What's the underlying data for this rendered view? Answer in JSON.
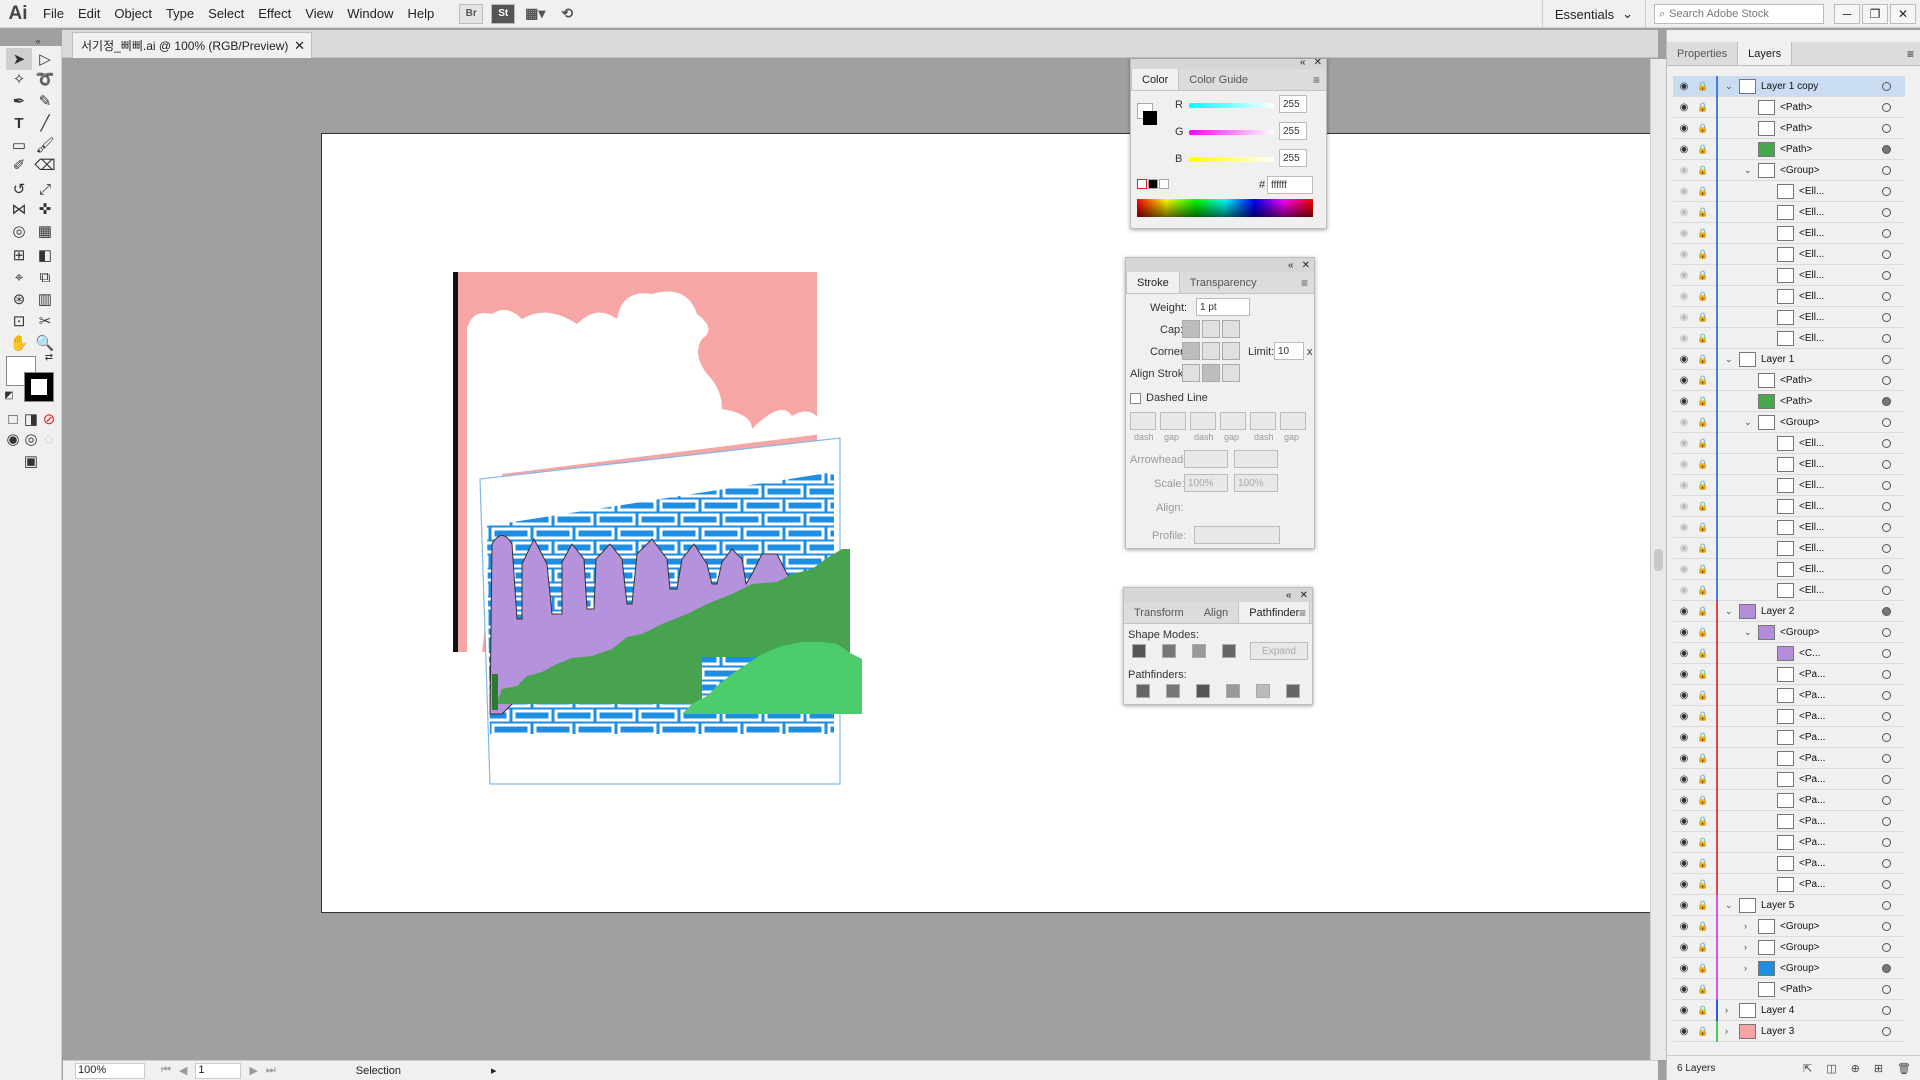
{
  "app": {
    "logo": "Ai"
  },
  "menubar": {
    "items": [
      "File",
      "Edit",
      "Object",
      "Type",
      "Select",
      "Effect",
      "View",
      "Window",
      "Help"
    ],
    "bridge_label": "Br",
    "stock_label": "St",
    "workspace": "Essentials",
    "search_placeholder": "Search Adobe Stock"
  },
  "document": {
    "tab_title": "서기정_삐삐.ai @ 100% (RGB/Preview)"
  },
  "status": {
    "zoom": "100%",
    "artboard": "1",
    "tool": "Selection"
  },
  "color_panel": {
    "tabs": [
      "Color",
      "Color Guide"
    ],
    "r_label": "R",
    "g_label": "G",
    "b_label": "B",
    "r": "255",
    "g": "255",
    "b": "255",
    "hex_label": "#",
    "hex": "ffffff"
  },
  "stroke_panel": {
    "tabs": [
      "Stroke",
      "Transparency"
    ],
    "weight_label": "Weight:",
    "weight": "1 pt",
    "cap_label": "Cap:",
    "corner_label": "Corner:",
    "limit_label": "Limit:",
    "limit": "10",
    "limit_unit": "x",
    "align_label": "Align Stroke:",
    "dashed_label": "Dashed Line",
    "dash_labels": [
      "dash",
      "gap",
      "dash",
      "gap",
      "dash",
      "gap"
    ],
    "arrowheads_label": "Arrowheads:",
    "scale_label": "Scale:",
    "scale1": "100%",
    "scale2": "100%",
    "align2_label": "Align:",
    "profile_label": "Profile:"
  },
  "pathfinder_panel": {
    "tabs": [
      "Transform",
      "Align",
      "Pathfinder"
    ],
    "shape_modes_label": "Shape Modes:",
    "expand_label": "Expand",
    "pathfinders_label": "Pathfinders:"
  },
  "dock": {
    "tabs": [
      "Properties",
      "Layers"
    ]
  },
  "layers": [
    {
      "name": "Layer 1 copy",
      "level": 0,
      "color": "#4a7be0",
      "expand": "v",
      "sel": true,
      "eye": true,
      "lock": true,
      "thumb": "#ffffff",
      "target": "ring"
    },
    {
      "name": "<Path>",
      "level": 1,
      "color": "#4a7be0",
      "eye": true,
      "lock": true,
      "thumb": "#ffffff",
      "target": "ring"
    },
    {
      "name": "<Path>",
      "level": 1,
      "color": "#4a7be0",
      "eye": true,
      "lock": false,
      "thumb": "#ffffff",
      "target": "ring"
    },
    {
      "name": "<Path>",
      "level": 1,
      "color": "#4a7be0",
      "eye": true,
      "lock": false,
      "thumb": "#47a84d",
      "target": "fill"
    },
    {
      "name": "<Group>",
      "level": 1,
      "color": "#4a7be0",
      "expand": "v",
      "eye": false,
      "lock": false,
      "thumb": "#ffffff",
      "target": "ring"
    },
    {
      "name": "<Ell...",
      "level": 2,
      "color": "#4a7be0",
      "eye": false,
      "lock": false,
      "thumb": "#ffffff",
      "target": "ring"
    },
    {
      "name": "<Ell...",
      "level": 2,
      "color": "#4a7be0",
      "eye": false,
      "lock": false,
      "thumb": "#ffffff",
      "target": "ring"
    },
    {
      "name": "<Ell...",
      "level": 2,
      "color": "#4a7be0",
      "eye": false,
      "lock": false,
      "thumb": "#ffffff",
      "target": "ring"
    },
    {
      "name": "<Ell...",
      "level": 2,
      "color": "#4a7be0",
      "eye": false,
      "lock": false,
      "thumb": "#ffffff",
      "target": "ring"
    },
    {
      "name": "<Ell...",
      "level": 2,
      "color": "#4a7be0",
      "eye": false,
      "lock": false,
      "thumb": "#ffffff",
      "target": "ring"
    },
    {
      "name": "<Ell...",
      "level": 2,
      "color": "#4a7be0",
      "eye": false,
      "lock": false,
      "thumb": "#ffffff",
      "target": "ring"
    },
    {
      "name": "<Ell...",
      "level": 2,
      "color": "#4a7be0",
      "eye": false,
      "lock": false,
      "thumb": "#ffffff",
      "target": "ring"
    },
    {
      "name": "<Ell...",
      "level": 2,
      "color": "#4a7be0",
      "eye": false,
      "lock": false,
      "thumb": "#ffffff",
      "target": "ring"
    },
    {
      "name": "Layer 1",
      "level": 0,
      "color": "#4a7be0",
      "expand": "v",
      "eye": true,
      "lock": true,
      "thumb": "#ffffff",
      "target": "ring"
    },
    {
      "name": "<Path>",
      "level": 1,
      "color": "#4a7be0",
      "eye": true,
      "lock": false,
      "thumb": "#ffffff",
      "target": "ring"
    },
    {
      "name": "<Path>",
      "level": 1,
      "color": "#4a7be0",
      "eye": true,
      "lock": false,
      "thumb": "#47a84d",
      "target": "fill"
    },
    {
      "name": "<Group>",
      "level": 1,
      "color": "#4a7be0",
      "expand": "v",
      "eye": false,
      "lock": false,
      "thumb": "#ffffff",
      "target": "ring"
    },
    {
      "name": "<Ell...",
      "level": 2,
      "color": "#4a7be0",
      "eye": false,
      "lock": false,
      "thumb": "#ffffff",
      "target": "ring"
    },
    {
      "name": "<Ell...",
      "level": 2,
      "color": "#4a7be0",
      "eye": false,
      "lock": false,
      "thumb": "#ffffff",
      "target": "ring"
    },
    {
      "name": "<Ell...",
      "level": 2,
      "color": "#4a7be0",
      "eye": false,
      "lock": false,
      "thumb": "#ffffff",
      "target": "ring"
    },
    {
      "name": "<Ell...",
      "level": 2,
      "color": "#4a7be0",
      "eye": false,
      "lock": false,
      "thumb": "#ffffff",
      "target": "ring"
    },
    {
      "name": "<Ell...",
      "level": 2,
      "color": "#4a7be0",
      "eye": false,
      "lock": false,
      "thumb": "#ffffff",
      "target": "ring"
    },
    {
      "name": "<Ell...",
      "level": 2,
      "color": "#4a7be0",
      "eye": false,
      "lock": false,
      "thumb": "#ffffff",
      "target": "ring"
    },
    {
      "name": "<Ell...",
      "level": 2,
      "color": "#4a7be0",
      "eye": false,
      "lock": false,
      "thumb": "#ffffff",
      "target": "ring"
    },
    {
      "name": "<Ell...",
      "level": 2,
      "color": "#4a7be0",
      "eye": false,
      "lock": false,
      "thumb": "#ffffff",
      "target": "ring"
    },
    {
      "name": "Layer 2",
      "level": 0,
      "color": "#e04848",
      "expand": "v",
      "eye": true,
      "lock": true,
      "thumb": "#b38ddc",
      "target": "fill"
    },
    {
      "name": "<Group>",
      "level": 1,
      "color": "#e04848",
      "expand": "v",
      "eye": true,
      "lock": false,
      "thumb": "#b38ddc",
      "target": "ring"
    },
    {
      "name": "<C...",
      "level": 2,
      "color": "#e04848",
      "eye": true,
      "lock": false,
      "thumb": "#b38ddc",
      "target": "ring"
    },
    {
      "name": "<Pa...",
      "level": 2,
      "color": "#e04848",
      "eye": true,
      "lock": false,
      "thumb": "#ffffff",
      "target": "ring"
    },
    {
      "name": "<Pa...",
      "level": 2,
      "color": "#e04848",
      "eye": true,
      "lock": false,
      "thumb": "#ffffff",
      "target": "ring"
    },
    {
      "name": "<Pa...",
      "level": 2,
      "color": "#e04848",
      "eye": true,
      "lock": false,
      "thumb": "#ffffff",
      "target": "ring"
    },
    {
      "name": "<Pa...",
      "level": 2,
      "color": "#e04848",
      "eye": true,
      "lock": false,
      "thumb": "#ffffff",
      "target": "ring"
    },
    {
      "name": "<Pa...",
      "level": 2,
      "color": "#e04848",
      "eye": true,
      "lock": false,
      "thumb": "#ffffff",
      "target": "ring"
    },
    {
      "name": "<Pa...",
      "level": 2,
      "color": "#e04848",
      "eye": true,
      "lock": false,
      "thumb": "#ffffff",
      "target": "ring"
    },
    {
      "name": "<Pa...",
      "level": 2,
      "color": "#e04848",
      "eye": true,
      "lock": false,
      "thumb": "#ffffff",
      "target": "ring"
    },
    {
      "name": "<Pa...",
      "level": 2,
      "color": "#e04848",
      "eye": true,
      "lock": false,
      "thumb": "#ffffff",
      "target": "ring"
    },
    {
      "name": "<Pa...",
      "level": 2,
      "color": "#e04848",
      "eye": true,
      "lock": false,
      "thumb": "#ffffff",
      "target": "ring"
    },
    {
      "name": "<Pa...",
      "level": 2,
      "color": "#e04848",
      "eye": true,
      "lock": false,
      "thumb": "#ffffff",
      "target": "ring"
    },
    {
      "name": "<Pa...",
      "level": 2,
      "color": "#e04848",
      "eye": true,
      "lock": false,
      "thumb": "#ffffff",
      "target": "ring"
    },
    {
      "name": "Layer 5",
      "level": 0,
      "color": "#e050e0",
      "expand": "v",
      "eye": true,
      "lock": false,
      "thumb": "#ffffff",
      "target": "ring"
    },
    {
      "name": "<Group>",
      "level": 1,
      "color": "#e050e0",
      "expand": ">",
      "eye": true,
      "lock": false,
      "thumb": "#ffffff",
      "target": "ring"
    },
    {
      "name": "<Group>",
      "level": 1,
      "color": "#e050e0",
      "expand": ">",
      "eye": true,
      "lock": false,
      "thumb": "#ffffff",
      "target": "ring"
    },
    {
      "name": "<Group>",
      "level": 1,
      "color": "#e050e0",
      "expand": ">",
      "eye": true,
      "lock": true,
      "thumb": "#1b8fe0",
      "target": "fill"
    },
    {
      "name": "<Path>",
      "level": 1,
      "color": "#e050e0",
      "eye": true,
      "lock": true,
      "thumb": "#ffffff",
      "target": "ring"
    },
    {
      "name": "Layer 4",
      "level": 0,
      "color": "#3355ee",
      "expand": ">",
      "eye": true,
      "lock": true,
      "thumb": "#ffffff",
      "target": "ring"
    },
    {
      "name": "Layer 3",
      "level": 0,
      "color": "#44cc55",
      "expand": ">",
      "eye": true,
      "lock": true,
      "thumb": "#f5a3a3",
      "target": "ring"
    }
  ],
  "layers_footer": {
    "count": "6 Layers"
  },
  "colors": {
    "pink": "#f7a6a6",
    "blue": "#1e8ee3",
    "lilac": "#b592dc",
    "green": "#47a34e",
    "lightgreen": "#4ccc6a"
  }
}
